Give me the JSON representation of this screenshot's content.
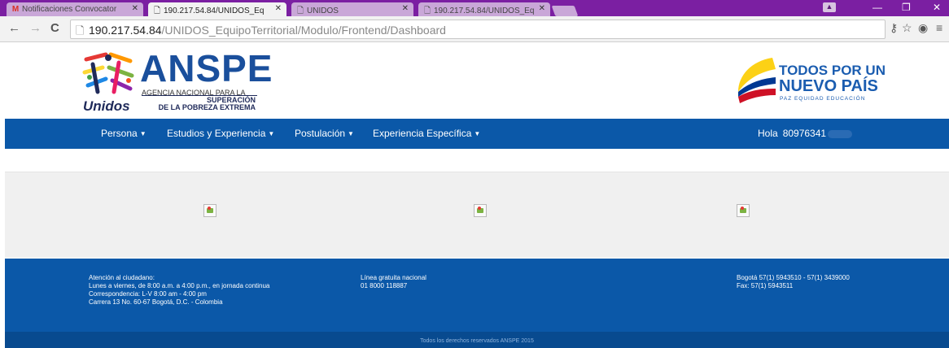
{
  "browser": {
    "tabs": [
      {
        "title": "Notificaciones Convocator",
        "icon": "gmail-icon",
        "active": false
      },
      {
        "title": "190.217.54.84/UNIDOS_Eq",
        "icon": "page-icon",
        "active": true
      },
      {
        "title": "UNIDOS",
        "icon": "page-icon",
        "active": false
      },
      {
        "title": "190.217.54.84/UNIDOS_Eq",
        "icon": "page-icon",
        "active": false
      }
    ],
    "url_host": "190.217.54.84",
    "url_path": "/UNIDOS_EquipoTerritorial/Modulo/Frontend/Dashboard"
  },
  "header": {
    "logo_left": {
      "word": "ANSPE",
      "line1": "AGENCIA NACIONAL PARA LA",
      "line2": "SUPERACIÓN",
      "line3": "DE LA POBREZA EXTREMA",
      "unidos": "Unidos"
    },
    "logo_right": {
      "line1": "TODOS POR UN",
      "line2": "NUEVO PAÍS",
      "line3": "PAZ  EQUIDAD  EDUCACIÓN"
    }
  },
  "nav": {
    "items": [
      {
        "label": "Persona"
      },
      {
        "label": "Estudios y Experiencia"
      },
      {
        "label": "Postulación"
      },
      {
        "label": "Experiencia Específica"
      }
    ],
    "greeting": "Hola",
    "user_id": "80976341"
  },
  "footer": {
    "col1": [
      "Atención al ciudadano:",
      "Lunes a viernes, de 8:00 a.m. a 4:00 p.m., en jornada continua",
      "Correspondencia: L-V 8:00 am - 4:00 pm",
      "Carrera 13 No. 60-67 Bogotá, D.C. - Colombia"
    ],
    "col2": [
      "Línea gratuita nacional",
      "01 8000 118887"
    ],
    "col3": [
      "Bogotá 57(1) 5943510 - 57(1) 3439000",
      "Fax: 57(1) 5943511"
    ],
    "copyright": "Todos los derechos reservados ANSPE 2015"
  },
  "colors": {
    "tab_strip": "#7b1fa2",
    "nav_blue": "#0b58a8",
    "subfooter_blue": "#084a8f",
    "content_gray": "#f0f0f0"
  }
}
